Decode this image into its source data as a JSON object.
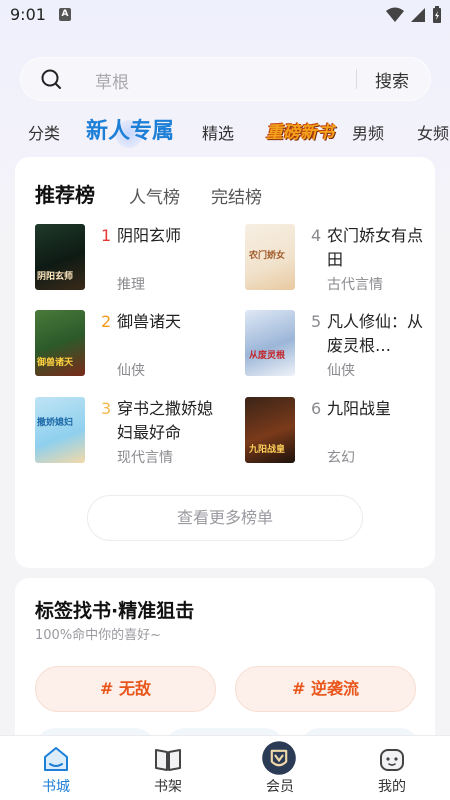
{
  "status": {
    "time": "9:01",
    "notif": "A"
  },
  "search": {
    "placeholder": "草根",
    "button": "搜索"
  },
  "categories": [
    "分类",
    "新人专属",
    "精选",
    "重磅新书",
    "男频",
    "女频"
  ],
  "ranking": {
    "tabs": [
      "推荐榜",
      "人气榜",
      "完结榜"
    ],
    "books": [
      {
        "rank": "1",
        "title": "阴阳玄师",
        "genre": "推理",
        "rank_color": "#e53935",
        "cover_text": "阴阳玄师"
      },
      {
        "rank": "2",
        "title": "御兽诸天",
        "genre": "仙侠",
        "rank_color": "#f29a1c",
        "cover_text": "御兽诸天"
      },
      {
        "rank": "3",
        "title": "穿书之撒娇媳妇最好命",
        "genre": "现代言情",
        "rank_color": "#f2b84b",
        "cover_text": "撒娇媳妇"
      },
      {
        "rank": "4",
        "title": "农门娇女有点田",
        "genre": "古代言情",
        "rank_color": "#8a8a8f",
        "cover_text": "农门娇女"
      },
      {
        "rank": "5",
        "title": "凡人修仙：从废灵根…",
        "genre": "仙侠",
        "rank_color": "#8a8a8f",
        "cover_text": "从废灵根"
      },
      {
        "rank": "6",
        "title": "九阳战皇",
        "genre": "玄幻",
        "rank_color": "#8a8a8f",
        "cover_text": "九阳战皇"
      }
    ],
    "more": "查看更多榜单"
  },
  "tags": {
    "title": "标签找书·精准狙击",
    "subtitle": "100%命中你的喜好~",
    "pills": [
      "# 无敌",
      "# 逆袭流"
    ]
  },
  "nav": [
    {
      "label": "书城",
      "icon": "home-icon"
    },
    {
      "label": "书架",
      "icon": "bookshelf-icon"
    },
    {
      "label": "会员",
      "icon": "vip-icon"
    },
    {
      "label": "我的",
      "icon": "profile-icon"
    }
  ],
  "colors": {
    "accent": "#1e7fd6",
    "tag_text": "#e8561c",
    "tag_bg": "#fdf0ea"
  }
}
